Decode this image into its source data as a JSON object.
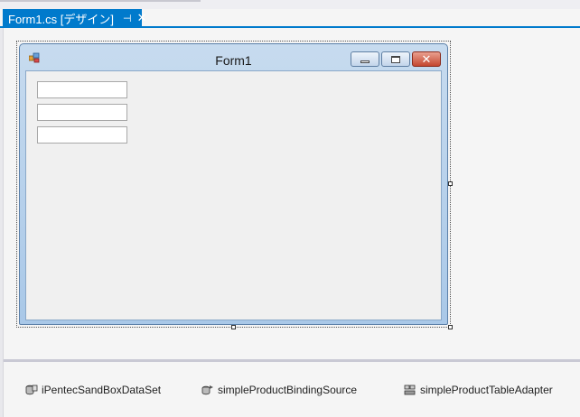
{
  "tab": {
    "title": "Form1.cs [デザイン]",
    "pin_glyph": "⊣",
    "close_glyph": "✕"
  },
  "form": {
    "title": "Form1",
    "caption_buttons": {
      "close_glyph": "✕"
    },
    "textboxes": [
      "",
      "",
      ""
    ]
  },
  "component_tray": {
    "items": [
      {
        "label": "iPentecSandBoxDataSet",
        "icon": "dataset-icon"
      },
      {
        "label": "simpleProductBindingSource",
        "icon": "binding-source-icon"
      },
      {
        "label": "simpleProductTableAdapter",
        "icon": "table-adapter-icon"
      }
    ]
  },
  "colors": {
    "tab_accent": "#007acc",
    "surface": "#f5f5f5",
    "form_frame": "#a9c8e8",
    "close_button": "#c44730"
  }
}
